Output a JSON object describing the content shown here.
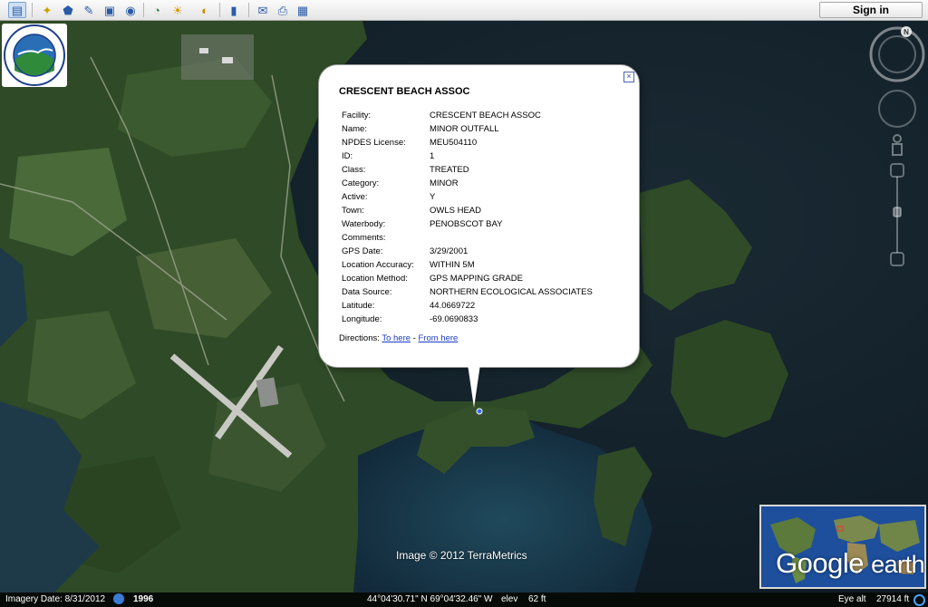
{
  "toolbar": {
    "buttons": [
      {
        "name": "sidebar-toggle-icon",
        "glyph": "▤"
      },
      {
        "name": "add-placemark-icon",
        "glyph": "✦"
      },
      {
        "name": "add-polygon-icon",
        "glyph": "⬟"
      },
      {
        "name": "add-path-icon",
        "glyph": "✎"
      },
      {
        "name": "add-image-overlay-icon",
        "glyph": "▣"
      },
      {
        "name": "record-tour-icon",
        "glyph": "◉"
      },
      {
        "name": "historical-imagery-icon",
        "glyph": "◔"
      },
      {
        "name": "sunlight-icon",
        "glyph": "☀"
      },
      {
        "name": "switch-to-sky-icon",
        "glyph": "◐"
      },
      {
        "name": "ruler-icon",
        "glyph": "▮"
      },
      {
        "name": "email-icon",
        "glyph": "✉"
      },
      {
        "name": "print-icon",
        "glyph": "⎙"
      },
      {
        "name": "view-in-maps-icon",
        "glyph": "▦"
      }
    ],
    "sign_in_label": "Sign in"
  },
  "popup": {
    "title": "CRESCENT BEACH ASSOC",
    "close_glyph": "×",
    "fields": [
      {
        "label": "Facility:",
        "value": "CRESCENT BEACH ASSOC"
      },
      {
        "label": "Name:",
        "value": "MINOR OUTFALL"
      },
      {
        "label": "NPDES License:",
        "value": "MEU504110"
      },
      {
        "label": "ID:",
        "value": "1"
      },
      {
        "label": "Class:",
        "value": "TREATED"
      },
      {
        "label": "Category:",
        "value": "MINOR"
      },
      {
        "label": "Active:",
        "value": "Y"
      },
      {
        "label": "Town:",
        "value": "OWLS HEAD"
      },
      {
        "label": "Waterbody:",
        "value": "PENOBSCOT BAY"
      },
      {
        "label": "Comments:",
        "value": ""
      },
      {
        "label": "GPS Date:",
        "value": "3/29/2001"
      },
      {
        "label": "Location Accuracy:",
        "value": "WITHIN 5M"
      },
      {
        "label": "Location Method:",
        "value": "GPS MAPPING GRADE"
      },
      {
        "label": "Data Source:",
        "value": "NORTHERN ECOLOGICAL ASSOCIATES"
      },
      {
        "label": "Latitude:",
        "value": "44.0669722"
      },
      {
        "label": "Longitude:",
        "value": "-69.0690833"
      }
    ],
    "directions_label": "Directions:",
    "to_here": "To here",
    "directions_sep": " - ",
    "from_here": "From here"
  },
  "map": {
    "imagery_credit": "Image © 2012 TerraMetrics",
    "logo_text_top": "DEPARTMENT OF ENVIRONMENTAL PROTECTION",
    "logo_text_bottom": "STATE OF MAINE",
    "compass_north": "N",
    "overview_brand": "Google",
    "overview_brand_earth": "earth"
  },
  "status": {
    "imagery_date": "Imagery Date: 8/31/2012",
    "historical_year": "1996",
    "coordinates": "44°04'30.71\" N  69°04'32.46\" W",
    "elev_label": "elev",
    "elev_value": "62 ft",
    "eye_alt_label": "Eye alt",
    "eye_alt_value": "27914 ft"
  },
  "colors": {
    "water": "#0f1f2c",
    "land": "#2f4a27",
    "link": "#1b3fc4"
  }
}
